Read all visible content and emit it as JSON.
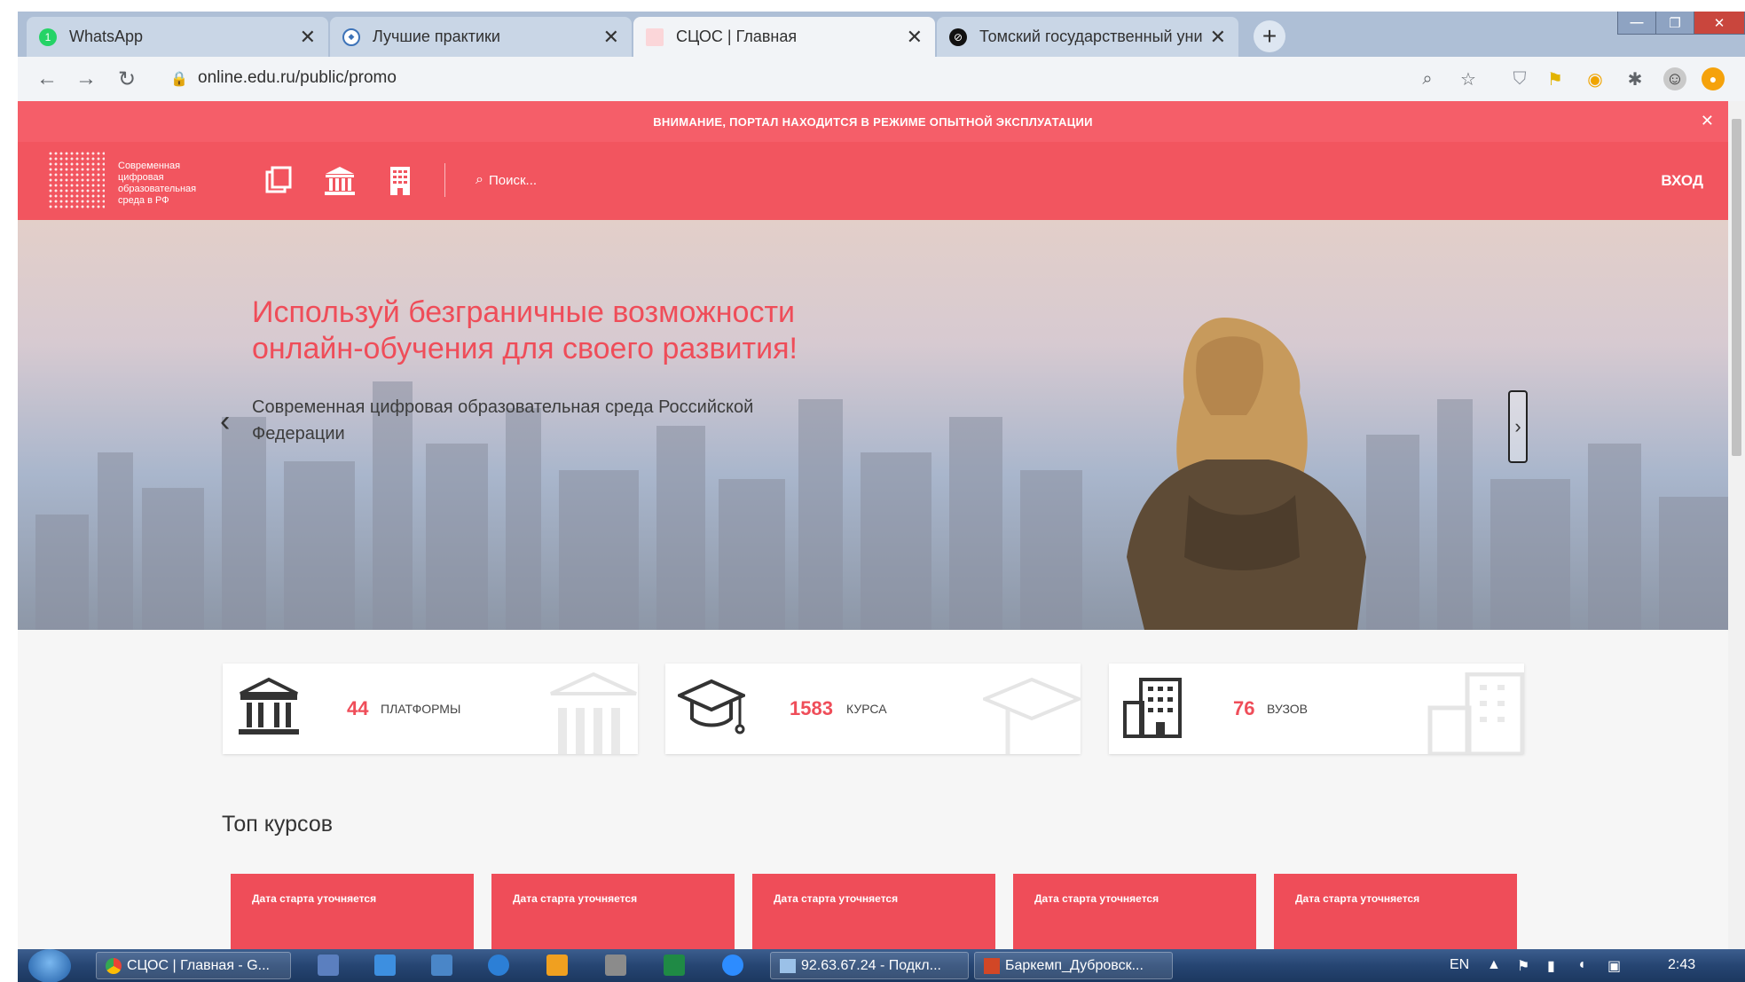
{
  "browser": {
    "tabs": [
      {
        "title": "WhatsApp",
        "active": false,
        "favicon": "whatsapp-icon"
      },
      {
        "title": "Лучшие практики",
        "active": false,
        "favicon": "shield-icon"
      },
      {
        "title": "СЦОС | Главная",
        "active": true,
        "favicon": "scos-icon"
      },
      {
        "title": "Томский государственный унив",
        "active": false,
        "favicon": "tsu-icon"
      }
    ],
    "url": "online.edu.ru/public/promo"
  },
  "site": {
    "notice": "ВНИМАНИЕ, ПОРТАЛ НАХОДИТСЯ В РЕЖИМЕ ОПЫТНОЙ ЭКСПЛУАТАЦИИ",
    "logo_text": "Современная цифровая образовательная среда в РФ",
    "search_placeholder": "Поиск...",
    "login": "ВХОД",
    "hero": {
      "title": "Используй безграничные возможности онлайн-обучения для своего развития!",
      "subtitle": "Современная цифровая образовательная среда Российской Федерации"
    },
    "stats": [
      {
        "number": "44",
        "label": "ПЛАТФОРМЫ",
        "icon": "institution-icon"
      },
      {
        "number": "1583",
        "label": "КУРСА",
        "icon": "graduation-cap-icon"
      },
      {
        "number": "76",
        "label": "ВУЗОВ",
        "icon": "building-icon"
      }
    ],
    "top_courses_title": "Топ курсов",
    "course_cards": [
      {
        "date": "Дата старта уточняется"
      },
      {
        "date": "Дата старта уточняется"
      },
      {
        "date": "Дата старта уточняется"
      },
      {
        "date": "Дата старта уточняется"
      },
      {
        "date": "Дата старта уточняется"
      }
    ]
  },
  "taskbar": {
    "items": [
      {
        "label": "СЦОС | Главная - G..."
      },
      {
        "label": "92.63.67.24 - Подкл..."
      },
      {
        "label": "Баркемп_Дубровск..."
      }
    ],
    "lang": "EN",
    "clock": "2:43"
  },
  "colors": {
    "accent": "#f2555f",
    "accent_text": "#ef4d59",
    "notice": "#f55e69"
  }
}
